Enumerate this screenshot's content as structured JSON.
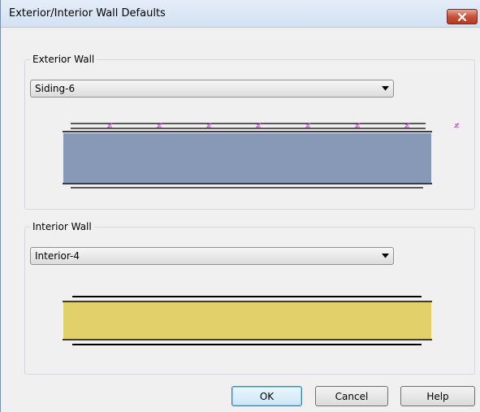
{
  "window": {
    "title": "Exterior/Interior Wall Defaults",
    "close_icon": "close-x-icon"
  },
  "exterior": {
    "group_label": "Exterior Wall",
    "selected": "Siding-6",
    "fill_color": "#8899b8",
    "siding_mark_color": "#c050d0"
  },
  "interior": {
    "group_label": "Interior Wall",
    "selected": "Interior-4",
    "fill_color": "#e2d16a"
  },
  "buttons": {
    "ok": "OK",
    "cancel": "Cancel",
    "help": "Help"
  }
}
